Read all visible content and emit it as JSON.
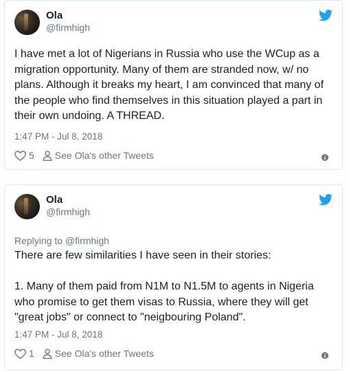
{
  "tweets": [
    {
      "name": "Ola",
      "handle": "@firmhigh",
      "replying": "",
      "text": "I have met a lot of Nigerians in Russia who use the WCup as a migration opportunity. Many of them are stranded now, w/ no plans. Although it breaks my heart, I am convinced that many of the people who find themselves in this situation played a part in their own undoing. A THREAD.",
      "time": "1:47 PM - Jul 8, 2018",
      "likes": "5",
      "see_other": "See Ola's other Tweets"
    },
    {
      "name": "Ola",
      "handle": "@firmhigh",
      "replying": "Replying to @firmhigh",
      "text": "There are few similarities I have seen in their stories:\n\n1. Many of them paid from N1M to N1.5M to agents in Nigeria who promise to get them visas to Russia, where they will get \"great jobs\" or connect to \"neigbouring Poland\".",
      "time": "1:47 PM - Jul 8, 2018",
      "likes": "1",
      "see_other": "See Ola's other Tweets"
    }
  ],
  "colors": {
    "twitter_blue": "#1da1f2",
    "muted": "#697882",
    "border": "#e1e8ed"
  },
  "icons": [
    "twitter-bird-icon",
    "heart-icon",
    "person-icon",
    "info-icon"
  ]
}
